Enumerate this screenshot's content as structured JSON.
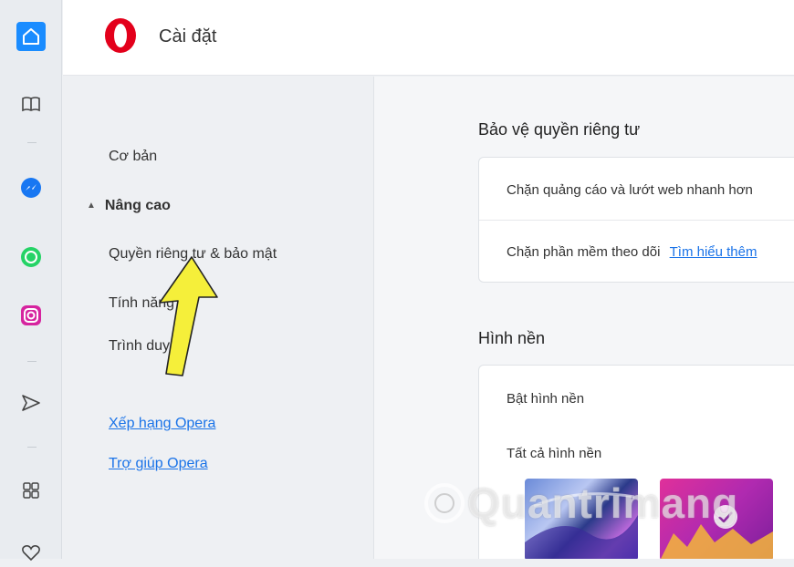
{
  "header": {
    "title": "Cài đặt"
  },
  "nav": {
    "basic": "Cơ bản",
    "advanced": "Nâng cao",
    "advanced_caret": "▲",
    "privacy": "Quyền riêng tư & bảo mật",
    "features": "Tính năng",
    "browser": "Trình duyệt",
    "rate_opera": "Xếp hạng Opera",
    "help_opera": "Trợ giúp Opera"
  },
  "privacy_section": {
    "title": "Bảo vệ quyền riêng tư",
    "block_ads": "Chặn quảng cáo và lướt web nhanh hơn",
    "block_trackers": "Chặn phần mềm theo dõi",
    "learn_more": "Tìm hiểu thêm"
  },
  "wallpaper_section": {
    "title": "Hình nền",
    "enable": "Bật hình nền",
    "all": "Tất cả hình nền"
  },
  "watermark": "Quantrimang",
  "colors": {
    "accent": "#1a8cff",
    "link": "#1a73e8",
    "opera_red": "#e3001b",
    "arrow": "#f5ef3a"
  },
  "rail_icons": [
    "home-icon",
    "bookmarks-icon",
    "messenger-icon",
    "whatsapp-icon",
    "instagram-icon",
    "send-icon",
    "extensions-icon",
    "heart-icon"
  ]
}
